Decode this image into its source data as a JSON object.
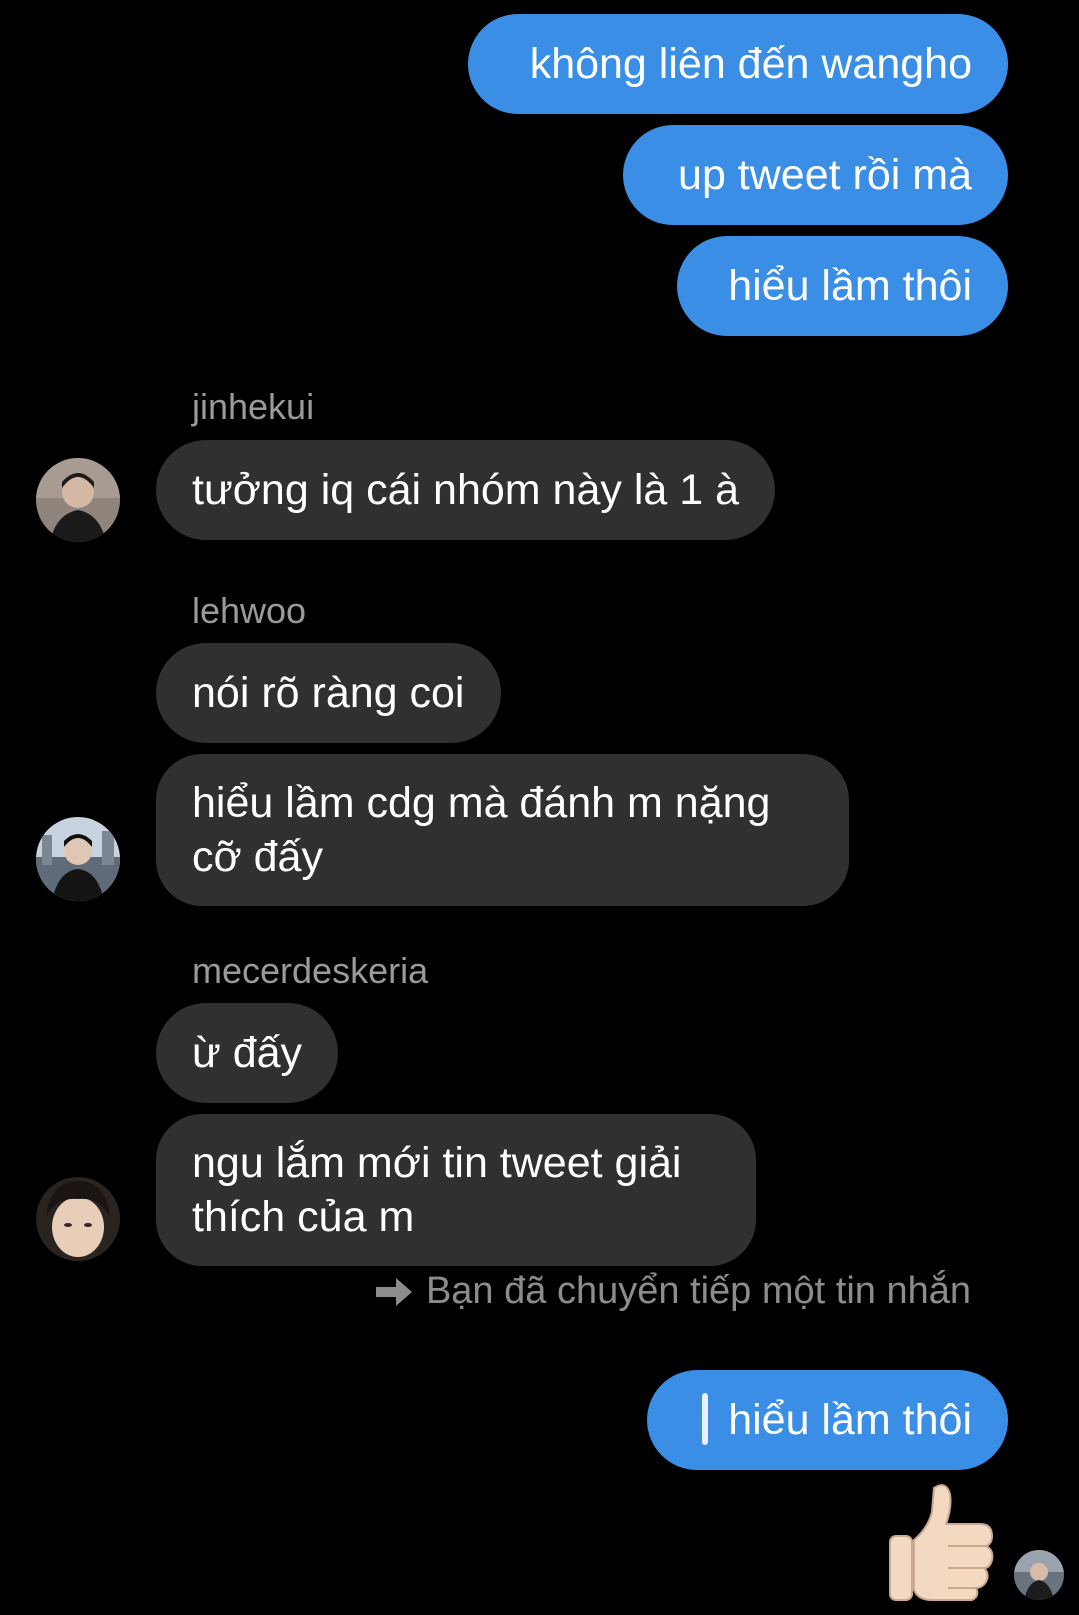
{
  "outgoing_top": [
    {
      "text": "không liên đến wangho"
    },
    {
      "text": "up tweet rồi mà"
    },
    {
      "text": "hiểu lầm thôi"
    }
  ],
  "groups": [
    {
      "sender": "jinhekui",
      "messages": [
        "tưởng iq cái nhóm này là 1 à"
      ]
    },
    {
      "sender": "lehwoo",
      "messages": [
        "nói rõ ràng coi",
        "hiểu lầm cdg mà đánh m nặng cỡ đấy"
      ]
    },
    {
      "sender": "mecerdeskeria",
      "messages": [
        "ừ đấy",
        "ngu lắm mới tin tweet giải thích của m"
      ]
    }
  ],
  "forward_note": "Bạn đã chuyển tiếp một tin nhắn",
  "forwarded_message": "hiểu lầm thôi",
  "reaction_icon": "thumbs-up-icon",
  "colors": {
    "background": "#000000",
    "outgoing_bubble": "#3a8ee6",
    "incoming_bubble": "#303030",
    "sender_name": "#9a9a9a",
    "meta_text": "#8c8c8c"
  }
}
